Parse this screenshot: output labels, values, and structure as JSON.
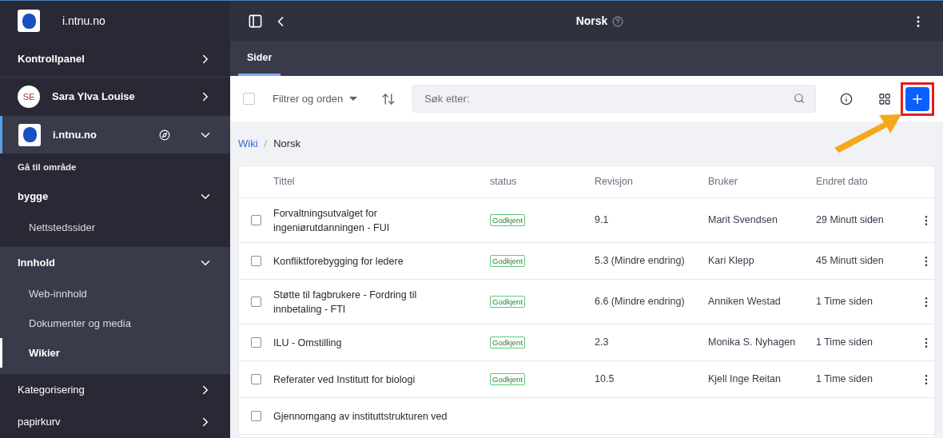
{
  "sidebar": {
    "site_title": "i.ntnu.no",
    "items": [
      {
        "kind": "link",
        "label": "Kontrollpanel",
        "expanded": false
      },
      {
        "kind": "user",
        "label": "Sara Ylva Louise",
        "initials": "SE",
        "expanded": false
      },
      {
        "kind": "site",
        "label": "i.ntnu.no",
        "selected": true,
        "expanded": true
      },
      {
        "kind": "heading",
        "label": "Gå til område"
      },
      {
        "kind": "group",
        "label": "bygge",
        "expanded": true,
        "children": [
          {
            "label": "Nettstedssider",
            "selected": false
          }
        ]
      },
      {
        "kind": "group",
        "label": "Innhold",
        "expanded": true,
        "children": [
          {
            "label": "Web-innhold",
            "selected": false
          },
          {
            "label": "Dokumenter og media",
            "selected": false
          },
          {
            "label": "Wikier",
            "selected": true
          }
        ]
      },
      {
        "kind": "group",
        "label": "Kategorisering",
        "expanded": false
      },
      {
        "kind": "group",
        "label": "papirkurv",
        "expanded": false
      }
    ]
  },
  "header": {
    "title": "Norsk"
  },
  "tabs": [
    {
      "label": "Sider",
      "selected": true
    }
  ],
  "toolbar": {
    "select_all_checked": false,
    "filter": "Filtrer og orden",
    "search": {
      "placeholder": "Søk etter:"
    },
    "add_highlighted": true
  },
  "breadcrumb": {
    "separator": "/",
    "items": [
      {
        "label": "Wiki",
        "link": true
      },
      {
        "label": "Norsk",
        "link": false
      }
    ]
  },
  "table": {
    "columns": [
      "Tittel",
      "status",
      "Revisjon",
      "Bruker",
      "Endret dato"
    ],
    "rows": [
      {
        "title": "Forvaltningsutvalget for ingeniørutdanningen - FUI",
        "status": "Godkjent",
        "revision": "9.1",
        "user": "Marit Svendsen",
        "modified": "29 Minutt siden",
        "checked": false
      },
      {
        "title": "Konfliktforebygging for ledere",
        "status": "Godkjent",
        "revision": "5.3 (Mindre endring)",
        "user": "Kari Klepp",
        "modified": "45 Minutt siden",
        "checked": false
      },
      {
        "title": "Støtte til fagbrukere - Fordring til innbetaling - FTI",
        "status": "Godkjent",
        "revision": "6.6 (Mindre endring)",
        "user": "Anniken Westad",
        "modified": "1 Time siden",
        "checked": false
      },
      {
        "title": "ILU - Omstilling",
        "status": "Godkjent",
        "revision": "2.3",
        "user": "Monika S. Nyhagen",
        "modified": "1 Time siden",
        "checked": false
      },
      {
        "title": "Referater ved Institutt for biologi",
        "status": "Godkjent",
        "revision": "10.5",
        "user": "Kjell Inge Reitan",
        "modified": "1 Time siden",
        "checked": false
      },
      {
        "title": "Gjennomgang av instituttstrukturen ved",
        "checked": false
      }
    ]
  }
}
